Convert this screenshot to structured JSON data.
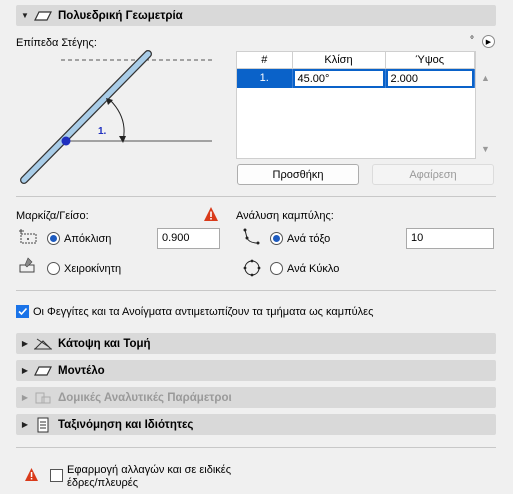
{
  "sections": {
    "polyhedral": {
      "title": "Πολυεδρική Γεωμετρία"
    },
    "floorplan": {
      "title": "Κάτοψη και Τομή"
    },
    "model": {
      "title": "Μοντέλο"
    },
    "structural": {
      "title": "Δομικές Αναλυτικές Παράμετροι"
    },
    "classification": {
      "title": "Ταξινόμηση και Ιδιότητες"
    }
  },
  "roof_levels": {
    "label": "Επίπεδα Στέγης:",
    "degree_symbol": "°",
    "diagram_marker": "1.",
    "table": {
      "columns": [
        "#",
        "Κλίση",
        "Ύψος"
      ],
      "rows": [
        {
          "num": "1.",
          "slope": "45.00°",
          "height": "2.000"
        }
      ]
    },
    "add_button": "Προσθήκη",
    "remove_button": "Αφαίρεση"
  },
  "eaves": {
    "label": "Μαρκίζα/Γείσο:",
    "offset_label": "Απόκλιση",
    "offset_value": "0.900",
    "manual_label": "Χειροκίνητη",
    "selected": "offset"
  },
  "curve": {
    "label": "Ανάλυση καμπύλης:",
    "per_arc_label": "Ανά τόξο",
    "per_arc_value": "10",
    "per_circle_label": "Ανά Κύκλο",
    "selected": "per_arc"
  },
  "openings_checkbox": {
    "label": "Οι Φεγγίτες και τα Ανοίγματα αντιμετωπίζουν τα τμήματα ως καμπύλες",
    "checked": true
  },
  "apply_changes": {
    "line1": "Εφαρμογή αλλαγών και σε ειδικές",
    "line2": "έδρες/πλευρές",
    "checked": false
  },
  "colors": {
    "accent": "#1a73e8",
    "warning": "#d93a1a",
    "selection": "#0a62c9"
  }
}
